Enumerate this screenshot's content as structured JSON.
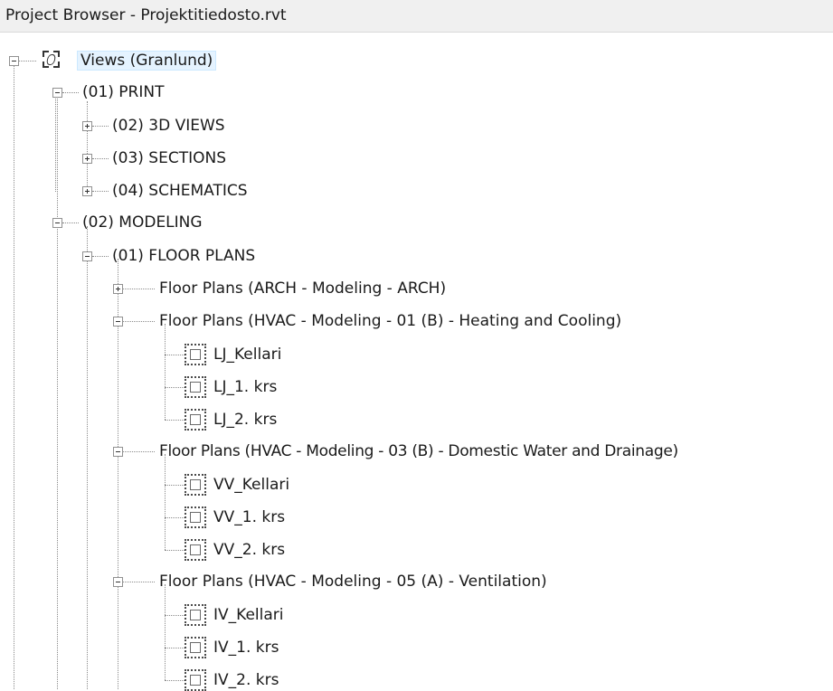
{
  "window": {
    "title": "Project Browser - Projektitiedosto.rvt"
  },
  "tree": {
    "root": {
      "label": "Views (Granlund)",
      "icon": "views-icon"
    },
    "print": {
      "label": "(01) PRINT",
      "children": [
        "(02) 3D VIEWS",
        "(03) SECTIONS",
        "(04) SCHEMATICS"
      ]
    },
    "modeling": {
      "label": "(02) MODELING",
      "floor_plans": {
        "label": "(01) FLOOR PLANS",
        "arch": {
          "label": "Floor Plans (ARCH - Modeling - ARCH)"
        },
        "heating": {
          "label": "Floor Plans (HVAC - Modeling - 01 (B) - Heating and Cooling)",
          "views": [
            "LJ_Kellari",
            "LJ_1. krs",
            "LJ_2. krs"
          ]
        },
        "water": {
          "label": "Floor Plans (HVAC - Modeling - 03 (B) - Domestic Water and Drainage)",
          "views": [
            "VV_Kellari",
            "VV_1. krs",
            "VV_2. krs"
          ]
        },
        "ventilation": {
          "label": "Floor Plans (HVAC - Modeling - 05 (A) - Ventilation)",
          "views": [
            "IV_Kellari",
            "IV_1. krs",
            "IV_2. krs"
          ]
        }
      }
    }
  }
}
